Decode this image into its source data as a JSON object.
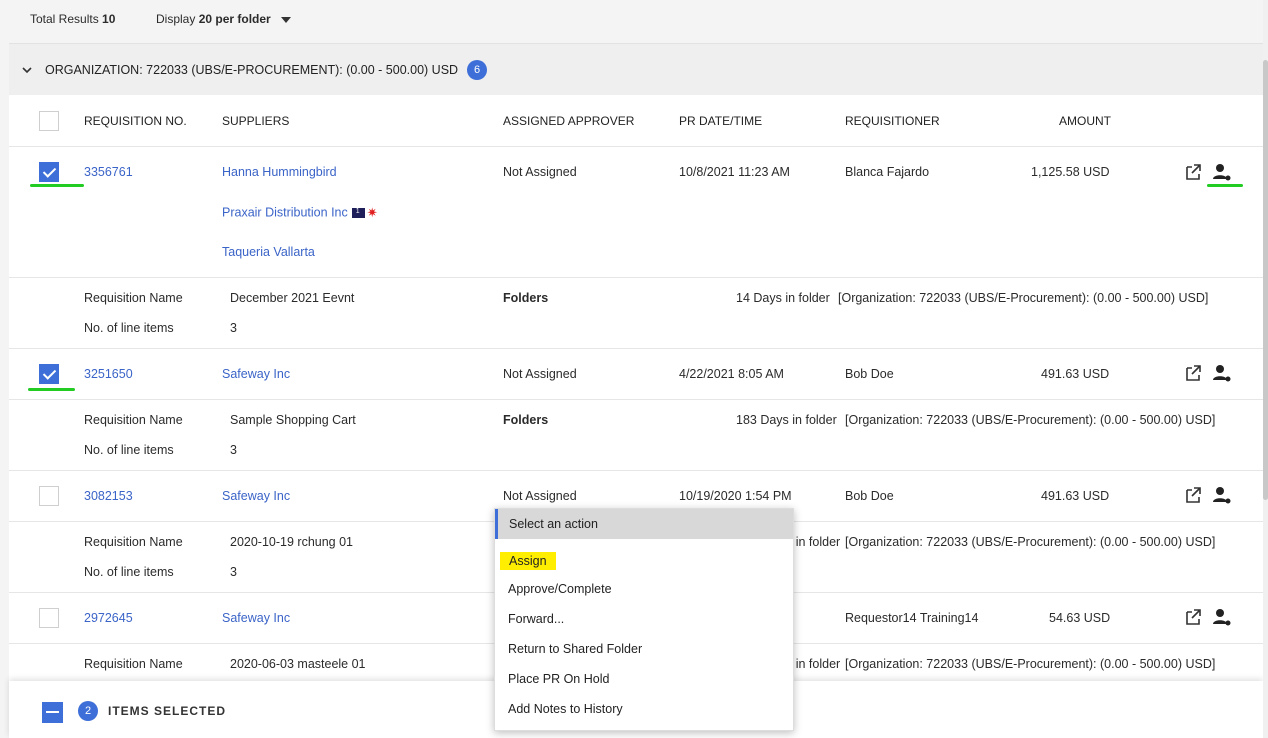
{
  "topbar": {
    "total_label": "Total Results",
    "total_value": "10",
    "display_label": "Display",
    "display_value": "20 per folder"
  },
  "org": {
    "title": "ORGANIZATION: 722033 (UBS/E-PROCUREMENT): (0.00 - 500.00) USD",
    "count": "6"
  },
  "columns": {
    "req_no": "REQUISITION NO.",
    "suppliers": "SUPPLIERS",
    "approver": "ASSIGNED APPROVER",
    "date": "PR DATE/TIME",
    "requisitioner": "REQUISITIONER",
    "amount": "AMOUNT"
  },
  "labels": {
    "req_name": "Requisition Name",
    "line_items": "No. of line items",
    "folders": "Folders"
  },
  "rows": [
    {
      "number": "3356761",
      "suppliers": [
        "Hanna Hummingbird",
        "Praxair Distribution Inc",
        "Taqueria Vallarta"
      ],
      "approver": "Not Assigned",
      "date": "10/8/2021 11:23 AM",
      "requisitioner": "Blanca Fajardo",
      "amount": "1,125.58 USD",
      "checked": true,
      "req_name": "December 2021 Eevnt",
      "line_items": "3",
      "days": "14 Days in folder",
      "folder": "[Organization: 722033 (UBS/E-Procurement): (0.00 - 500.00) USD]"
    },
    {
      "number": "3251650",
      "suppliers": [
        "Safeway Inc"
      ],
      "approver": "Not Assigned",
      "date": "4/22/2021 8:05 AM",
      "requisitioner": "Bob Doe",
      "amount": "491.63 USD",
      "checked": true,
      "req_name": "Sample Shopping Cart",
      "line_items": "3",
      "days": "183 Days in folder",
      "folder": "[Organization: 722033 (UBS/E-Procurement): (0.00 - 500.00) USD]"
    },
    {
      "number": "3082153",
      "suppliers": [
        "Safeway Inc"
      ],
      "approver": "Not Assigned",
      "date": "10/19/2020 1:54 PM",
      "requisitioner": "Bob Doe",
      "amount": "491.63 USD",
      "checked": false,
      "req_name": "2020-10-19 rchung 01",
      "line_items": "3",
      "days_partial": "s in folder",
      "folder": "[Organization: 722033 (UBS/E-Procurement): (0.00 - 500.00) USD]"
    },
    {
      "number": "2972645",
      "suppliers": [
        "Safeway Inc"
      ],
      "requisitioner": "Requestor14 Training14",
      "amount": "54.63 USD",
      "checked": false,
      "req_name": "2020-06-03 masteele 01",
      "days_partial": "s in folder",
      "folder": "[Organization: 722033 (UBS/E-Procurement): (0.00 - 500.00) USD]"
    }
  ],
  "menu": {
    "header": "Select an action",
    "items": [
      "Assign",
      "Approve/Complete",
      "Forward...",
      "Return to Shared Folder",
      "Place PR On Hold",
      "Add Notes to History"
    ]
  },
  "selection": {
    "count": "2",
    "label": "ITEMS SELECTED"
  },
  "colors": {
    "accent": "#3e6fd8",
    "link": "#3b64c8",
    "highlight": "#ffee00",
    "underline": "#22cc22"
  }
}
